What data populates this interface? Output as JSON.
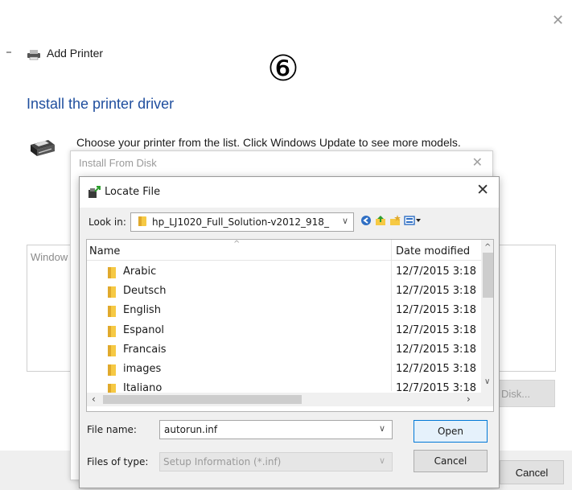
{
  "wizard": {
    "title": "Add Printer",
    "step_marker": "⑥",
    "heading": "Install the printer driver",
    "description": "Choose your printer from the list. Click Windows Update to see more models.",
    "list_label": "Window",
    "have_disk_label": "Disk...",
    "cancel_label": "Cancel"
  },
  "install_from_disk": {
    "title": "Install From Disk"
  },
  "locate_file": {
    "title": "Locate File",
    "look_in_label": "Look in:",
    "look_in_value": "hp_LJ1020_Full_Solution-v2012_918_",
    "columns": {
      "name": "Name",
      "date": "Date modified"
    },
    "files": [
      {
        "name": "Arabic",
        "date": "12/7/2015 3:18"
      },
      {
        "name": "Deutsch",
        "date": "12/7/2015 3:18"
      },
      {
        "name": "English",
        "date": "12/7/2015 3:18"
      },
      {
        "name": "Espanol",
        "date": "12/7/2015 3:18"
      },
      {
        "name": "Francais",
        "date": "12/7/2015 3:18"
      },
      {
        "name": "images",
        "date": "12/7/2015 3:18"
      },
      {
        "name": "Italiano",
        "date": "12/7/2015 3:18"
      }
    ],
    "file_name_label": "File name:",
    "file_name_value": "autorun.inf",
    "file_type_label": "Files of type:",
    "file_type_value": "Setup Information (*.inf)",
    "open_label": "Open",
    "cancel_label": "Cancel"
  },
  "colors": {
    "heading_blue": "#1f4e9e",
    "folder_yellow": "#f6c944",
    "focus_blue": "#0078d7"
  },
  "icons": [
    "close-icon",
    "printer-icon",
    "folder-icon",
    "back-icon",
    "up-folder-icon",
    "new-folder-icon",
    "view-menu-icon",
    "chevron-down-icon"
  ]
}
